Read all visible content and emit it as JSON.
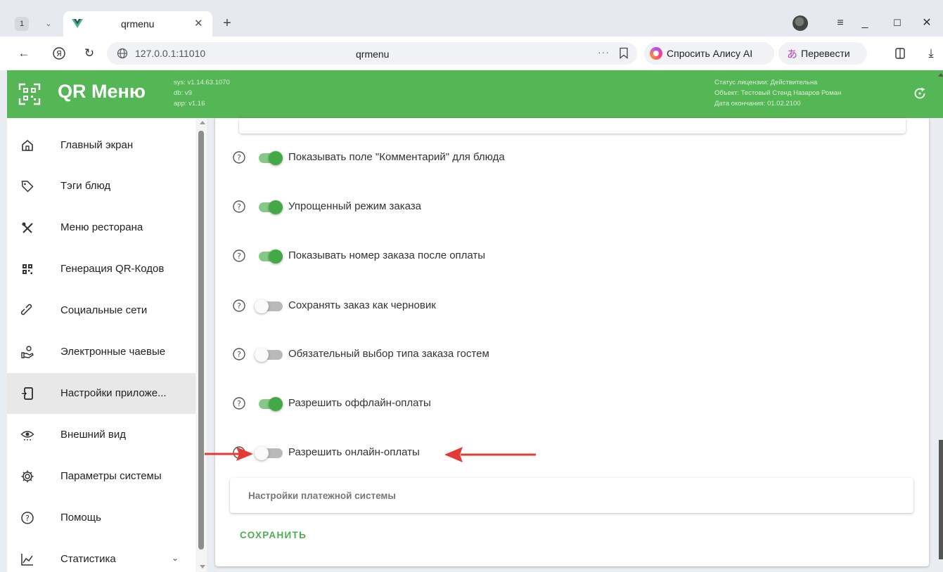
{
  "browser": {
    "tab_count": "1",
    "tab_title": "qrmenu",
    "url": "127.0.0.1:11010",
    "page_title": "qrmenu",
    "more_dots": "···",
    "alice_label": "Спросить Алису AI",
    "translate_label": "Перевести"
  },
  "header": {
    "app_title": "QR Меню",
    "sys_version": "sys: v1.14.63.1070",
    "db_version": "db: v9",
    "app_version": "app: v1.16",
    "license_status": "Статус лицензии: Действительна",
    "license_object": "Объект: Тестовый Стенд Назаров Роман",
    "license_end": "Дата окончания: 01.02.2100"
  },
  "sidebar": {
    "items": [
      {
        "label": "Главный экран",
        "icon": "home-icon"
      },
      {
        "label": "Тэги блюд",
        "icon": "tag-icon"
      },
      {
        "label": "Меню ресторана",
        "icon": "utensils-icon"
      },
      {
        "label": "Генерация QR-Кодов",
        "icon": "qr-code-icon"
      },
      {
        "label": "Социальные сети",
        "icon": "link-icon"
      },
      {
        "label": "Электронные чаевые",
        "icon": "tips-icon"
      },
      {
        "label": "Настройки приложе...",
        "icon": "app-settings-icon",
        "active": true
      },
      {
        "label": "Внешний вид",
        "icon": "eye-icon"
      },
      {
        "label": "Параметры системы",
        "icon": "gear-icon"
      },
      {
        "label": "Помощь",
        "icon": "help-icon"
      },
      {
        "label": "Статистика",
        "icon": "chart-icon",
        "expandable": true
      }
    ]
  },
  "settings": [
    {
      "label": "Показывать поле \"Комментарий\" для блюда",
      "enabled": true
    },
    {
      "label": "Упрощенный режим заказа",
      "enabled": true
    },
    {
      "label": "Показывать номер заказа после оплаты",
      "enabled": true
    },
    {
      "label": "Сохранять заказ как черновик",
      "enabled": false
    },
    {
      "label": "Обязательный выбор типа заказа гостем",
      "enabled": false
    },
    {
      "label": "Разрешить оффлайн-оплаты",
      "enabled": true
    },
    {
      "label": "Разрешить онлайн-оплаты",
      "enabled": false
    }
  ],
  "payment_panel": {
    "title": "Настройки платежной системы"
  },
  "actions": {
    "save_label": "СОХРАНИТЬ"
  },
  "colors": {
    "brand_green": "#55b655",
    "switch_on": "#43a947",
    "save_text": "#4caf50",
    "annotation_red": "#e53935"
  }
}
